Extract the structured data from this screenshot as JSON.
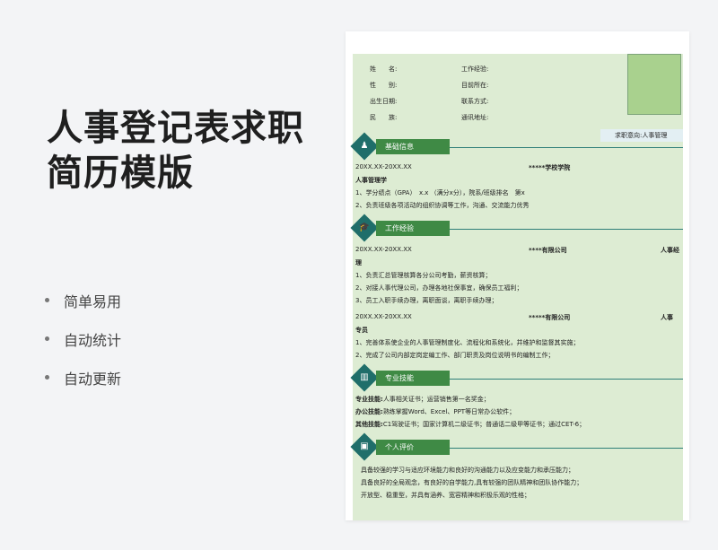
{
  "promo": {
    "title_line1": "人事登记表求职",
    "title_line2": "简历模版",
    "features": [
      "简单易用",
      "自动统计",
      "自动更新"
    ]
  },
  "resume": {
    "info_left": [
      {
        "label": "姓　　名:"
      },
      {
        "label": "性　　别:"
      },
      {
        "label": "出生日期:"
      },
      {
        "label": "民　　族:"
      }
    ],
    "info_right": [
      {
        "label": "工作经验:"
      },
      {
        "label": "目前所在:"
      },
      {
        "label": "联系方式:"
      },
      {
        "label": "通讯地址:"
      }
    ],
    "intent": "求职意向:人事管理",
    "sections": {
      "basic": "基础信息",
      "work": "工作经验",
      "skills": "专业技能",
      "eval": "个人评价"
    },
    "education": {
      "date": "20XX.XX-20XX.XX",
      "school": "*****学校学院",
      "major": "人事管理学",
      "items": [
        "1、学分绩点（GPA）　x.x （满分x分），院系/班级排名　第x",
        "2、负责班级各项活动的组织协调等工作，沟通、交流能力优秀"
      ]
    },
    "jobs": [
      {
        "date": "20XX.XX-20XX.XX",
        "company": "****有限公司",
        "role_a": "人事经",
        "role_b": "理",
        "items": [
          "1、负责汇总管理核算各分公司考勤，薪资核算；",
          "2、对接人事代理公司，办理各地社保事宜，确保员工福利；",
          "3、员工入职手续办理，离职面谈，离职手续办理；"
        ]
      },
      {
        "date": "20XX.XX-20XX.XX",
        "company": "*****有限公司",
        "role_a": "人事",
        "role_b": "专员",
        "items": [
          "1、完善体系使企业的人事管理制度化、流程化和系统化，并维护和监督其实施；",
          "2、完成了公司内部定岗定编工作、部门职责及岗位说明书的编制工作；"
        ]
      }
    ],
    "skills": [
      {
        "label": "专业技能:",
        "text": "人事相关证书；运营销售第一名奖金；"
      },
      {
        "label": "办公技能:",
        "text": "熟练掌握Word、Excel、PPT等日常办公软件；"
      },
      {
        "label": "其他技能:",
        "text": "C1驾驶证书；国家计算机二级证书；普通话二级甲等证书；通过CET-6；"
      }
    ],
    "evaluation": [
      "具备较强的学习与适应环境能力和良好的沟通能力以及应变能力和承压能力；",
      "具备良好的全局观念，有良好的自学能力,具有较强的团队精神和团队协作能力；",
      "开放型、稳重型，并具有涵养、宽容精神和积极乐观的性格；"
    ]
  }
}
